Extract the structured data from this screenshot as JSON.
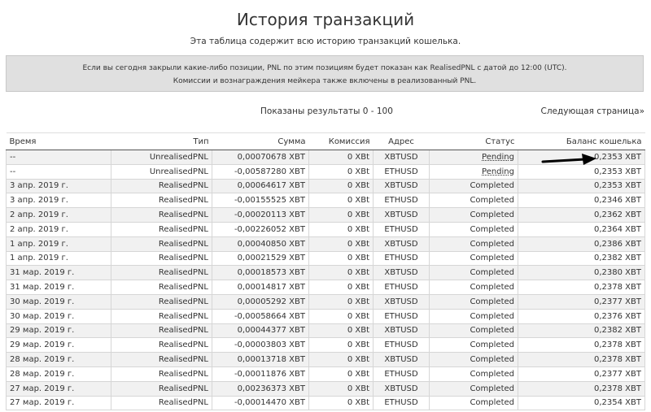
{
  "page": {
    "title": "История транзакций",
    "subtitle": "Эта таблица содержит всю историю транзакций кошелька.",
    "notice_line1": "Если вы сегодня закрыли какие-либо позиции, PNL по этим позициям будет показан как RealisedPNL с датой до 12:00 (UTC).",
    "notice_line2": "Комиссии и вознаграждения мейкера также включены в реализованный PNL.",
    "results_label": "Показаны результаты 0 - 100",
    "next_page_label": "Следующая страница»"
  },
  "table": {
    "headers": {
      "time": "Время",
      "type": "Тип",
      "amount": "Сумма",
      "fee": "Комиссия",
      "address": "Адрес",
      "status": "Статус",
      "balance": "Баланс кошелька"
    },
    "rows": [
      {
        "time": "--",
        "type": "UnrealisedPNL",
        "amount": "0,00070678 XBT",
        "fee": "0 XBt",
        "address": "XBTUSD",
        "status": "Pending",
        "balance": "0,2353 XBT"
      },
      {
        "time": "--",
        "type": "UnrealisedPNL",
        "amount": "-0,00587280 XBT",
        "fee": "0 XBt",
        "address": "ETHUSD",
        "status": "Pending",
        "balance": "0,2353 XBT"
      },
      {
        "time": "3 апр. 2019 г.",
        "type": "RealisedPNL",
        "amount": "0,00064617 XBT",
        "fee": "0 XBt",
        "address": "XBTUSD",
        "status": "Completed",
        "balance": "0,2353 XBT"
      },
      {
        "time": "3 апр. 2019 г.",
        "type": "RealisedPNL",
        "amount": "-0,00155525 XBT",
        "fee": "0 XBt",
        "address": "ETHUSD",
        "status": "Completed",
        "balance": "0,2346 XBT"
      },
      {
        "time": "2 апр. 2019 г.",
        "type": "RealisedPNL",
        "amount": "-0,00020113 XBT",
        "fee": "0 XBt",
        "address": "XBTUSD",
        "status": "Completed",
        "balance": "0,2362 XBT"
      },
      {
        "time": "2 апр. 2019 г.",
        "type": "RealisedPNL",
        "amount": "-0,00226052 XBT",
        "fee": "0 XBt",
        "address": "ETHUSD",
        "status": "Completed",
        "balance": "0,2364 XBT"
      },
      {
        "time": "1 апр. 2019 г.",
        "type": "RealisedPNL",
        "amount": "0,00040850 XBT",
        "fee": "0 XBt",
        "address": "XBTUSD",
        "status": "Completed",
        "balance": "0,2386 XBT"
      },
      {
        "time": "1 апр. 2019 г.",
        "type": "RealisedPNL",
        "amount": "0,00021529 XBT",
        "fee": "0 XBt",
        "address": "ETHUSD",
        "status": "Completed",
        "balance": "0,2382 XBT"
      },
      {
        "time": "31 мар. 2019 г.",
        "type": "RealisedPNL",
        "amount": "0,00018573 XBT",
        "fee": "0 XBt",
        "address": "XBTUSD",
        "status": "Completed",
        "balance": "0,2380 XBT"
      },
      {
        "time": "31 мар. 2019 г.",
        "type": "RealisedPNL",
        "amount": "0,00014817 XBT",
        "fee": "0 XBt",
        "address": "ETHUSD",
        "status": "Completed",
        "balance": "0,2378 XBT"
      },
      {
        "time": "30 мар. 2019 г.",
        "type": "RealisedPNL",
        "amount": "0,00005292 XBT",
        "fee": "0 XBt",
        "address": "XBTUSD",
        "status": "Completed",
        "balance": "0,2377 XBT"
      },
      {
        "time": "30 мар. 2019 г.",
        "type": "RealisedPNL",
        "amount": "-0,00058664 XBT",
        "fee": "0 XBt",
        "address": "ETHUSD",
        "status": "Completed",
        "balance": "0,2376 XBT"
      },
      {
        "time": "29 мар. 2019 г.",
        "type": "RealisedPNL",
        "amount": "0,00044377 XBT",
        "fee": "0 XBt",
        "address": "XBTUSD",
        "status": "Completed",
        "balance": "0,2382 XBT"
      },
      {
        "time": "29 мар. 2019 г.",
        "type": "RealisedPNL",
        "amount": "-0,00003803 XBT",
        "fee": "0 XBt",
        "address": "ETHUSD",
        "status": "Completed",
        "balance": "0,2378 XBT"
      },
      {
        "time": "28 мар. 2019 г.",
        "type": "RealisedPNL",
        "amount": "0,00013718 XBT",
        "fee": "0 XBt",
        "address": "XBTUSD",
        "status": "Completed",
        "balance": "0,2378 XBT"
      },
      {
        "time": "28 мар. 2019 г.",
        "type": "RealisedPNL",
        "amount": "-0,00011876 XBT",
        "fee": "0 XBt",
        "address": "ETHUSD",
        "status": "Completed",
        "balance": "0,2377 XBT"
      },
      {
        "time": "27 мар. 2019 г.",
        "type": "RealisedPNL",
        "amount": "0,00236373 XBT",
        "fee": "0 XBt",
        "address": "XBTUSD",
        "status": "Completed",
        "balance": "0,2378 XBT"
      },
      {
        "time": "27 мар. 2019 г.",
        "type": "RealisedPNL",
        "amount": "-0,00014470 XBT",
        "fee": "0 XBt",
        "address": "ETHUSD",
        "status": "Completed",
        "balance": "0,2354 XBT"
      }
    ]
  },
  "annotation": {
    "arrow_icon": "arrow-right-icon",
    "color": "#000000"
  }
}
